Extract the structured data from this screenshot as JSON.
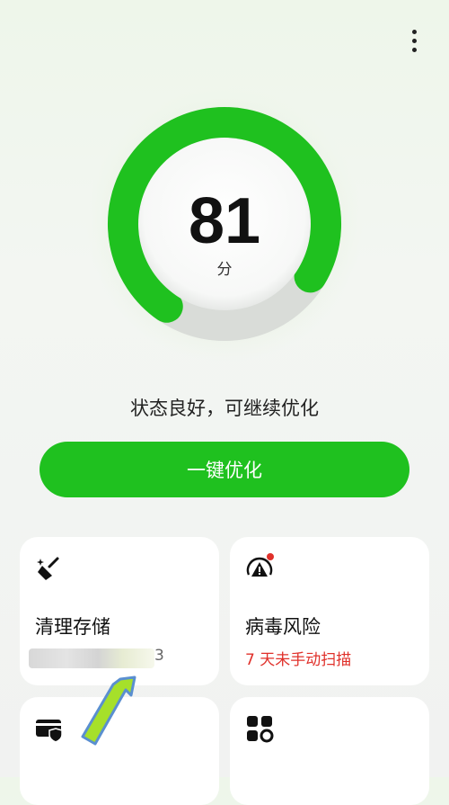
{
  "header": {
    "menu_icon": "more-vertical-icon"
  },
  "score": {
    "value": "81",
    "unit": "分",
    "progress": 0.81,
    "accent": "#1fc11f"
  },
  "status_text": "状态良好，可继续优化",
  "optimize_button": {
    "label": "一键优化",
    "color": "#1fc11f"
  },
  "cards": [
    {
      "title": "清理存储",
      "subtitle": "3",
      "icon": "broom-icon"
    },
    {
      "title": "病毒风险",
      "subtitle": "7 天未手动扫描",
      "subtitle_color": "#e0302a",
      "icon": "virus-alert-icon"
    },
    {
      "title": "",
      "icon": "payment-shield-icon"
    },
    {
      "title": "",
      "icon": "apps-settings-icon"
    }
  ]
}
